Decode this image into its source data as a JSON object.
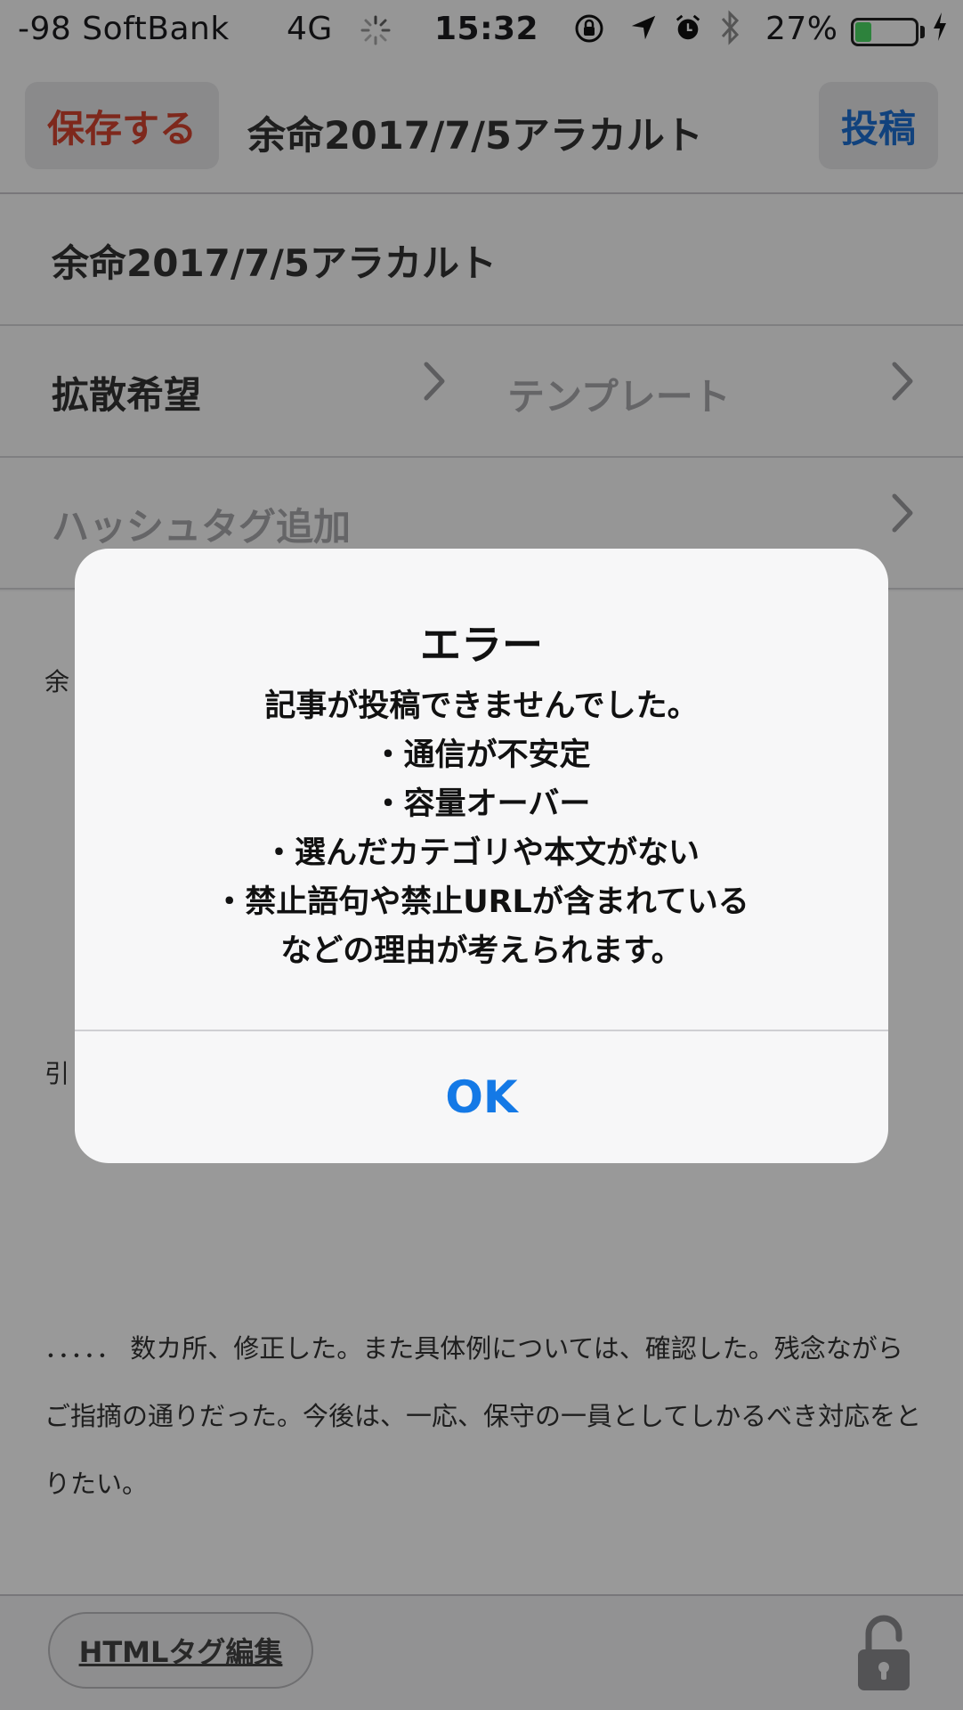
{
  "status_bar": {
    "carrier": "-98 SoftBank",
    "network": "4G",
    "time": "15:32",
    "battery_text": "27%",
    "battery_level": 0.27,
    "icons": [
      "loading-spinner-icon",
      "orientation-lock-icon",
      "location-arrow-icon",
      "alarm-icon",
      "bluetooth-icon",
      "battery-icon",
      "charging-bolt-icon"
    ]
  },
  "navbar": {
    "save_label": "保存する",
    "title": "余命2017/7/5アラカルト",
    "post_label": "投稿"
  },
  "form": {
    "title_value": "余命2017/7/5アラカルト",
    "diffusion_label": "拡散希望",
    "template_label": "テンプレート",
    "hashtag_placeholder": "ハッシュタグ追加"
  },
  "body": {
    "fragment_1": "余",
    "fragment_2": "引",
    "paragraph": "．．．．． 数カ所、修正した。また具体例については、確認した。残念ながらご指摘の通りだった。今後は、一応、保守の一員としてしかるべき対応をとりたい。"
  },
  "toolbar": {
    "html_edit_label": "HTMLタグ編集"
  },
  "alert": {
    "title": "エラー",
    "lines": [
      "記事が投稿できませんでした。",
      "・通信が不安定",
      "・容量オーバー",
      "・選んだカテゴリや本文がない",
      "・禁止語句や禁止URLが含まれている",
      "などの理由が考えられます。"
    ],
    "ok_label": "OK"
  },
  "colors": {
    "save_red": "#d2432f",
    "post_blue": "#1d6fd0",
    "ok_blue": "#1479e6",
    "battery_green": "#4cd964"
  }
}
